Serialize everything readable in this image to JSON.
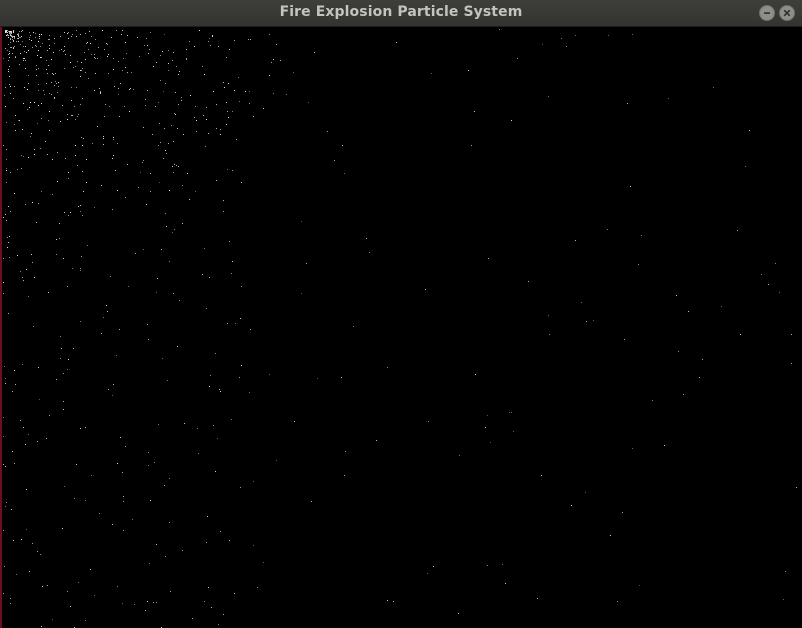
{
  "window": {
    "title": "Fire Explosion Particle System",
    "minimize_icon": "minus-icon",
    "close_icon": "x-icon"
  },
  "canvas": {
    "background": "#000000",
    "particle_color": "#e8e8e8"
  }
}
